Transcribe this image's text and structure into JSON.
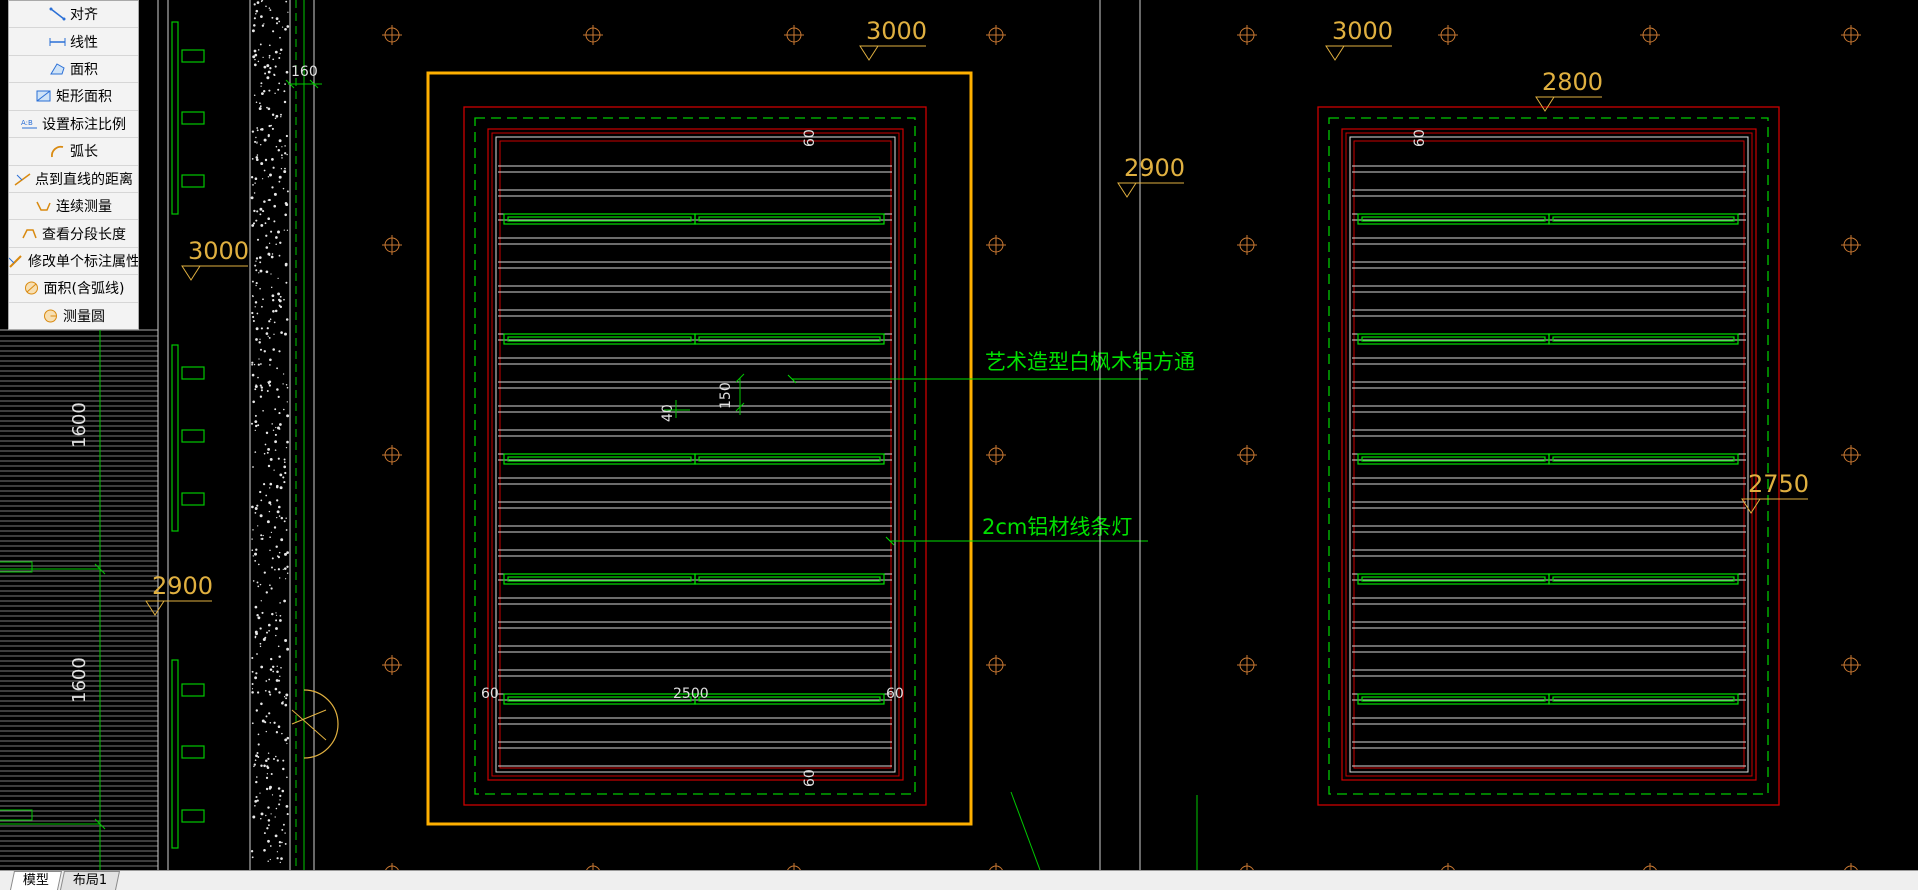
{
  "tools": [
    {
      "label": "对齐",
      "icon": "align-dimension-icon"
    },
    {
      "label": "线性",
      "icon": "linear-dimension-icon"
    },
    {
      "label": "面积",
      "icon": "area-icon"
    },
    {
      "label": "矩形面积",
      "icon": "rectangle-area-icon"
    },
    {
      "label": "设置标注比例",
      "icon": "annotation-scale-icon"
    },
    {
      "label": "弧长",
      "icon": "arc-length-icon"
    },
    {
      "label": "点到直线的距离",
      "icon": "point-to-line-distance-icon"
    },
    {
      "label": "连续测量",
      "icon": "continuous-measure-icon"
    },
    {
      "label": "查看分段长度",
      "icon": "segment-length-icon"
    },
    {
      "label": "修改单个标注属性",
      "icon": "edit-annotation-icon"
    },
    {
      "label": "面积(含弧线)",
      "icon": "area-with-arc-icon"
    },
    {
      "label": "测量圆",
      "icon": "measure-circle-icon"
    }
  ],
  "tabs": [
    {
      "label": "模型",
      "active": true
    },
    {
      "label": "布局1",
      "active": false
    }
  ],
  "drawing": {
    "annotations": {
      "aluminum_tube": "艺术造型白枫木铝方通",
      "strip_light": "2cm铝材线条灯"
    },
    "level_marks": {
      "top_left_3000": "3000",
      "top_right_3000": "3000",
      "right_panel_2800": "2800",
      "left_panel_2900": "2900",
      "left_3000": "3000",
      "left_2900": "2900",
      "right_2750": "2750"
    },
    "dimensions": {
      "wall_160": "160",
      "span_1600_top": "1600",
      "span_1600_bottom": "1600",
      "spacing_150": "150",
      "spacing_40": "40",
      "left_panel_width_2500": "2500",
      "left_panel_margin_left_60": "60",
      "left_panel_margin_right_60": "60",
      "left_panel_margin_top_60": "60",
      "left_panel_margin_bottom_60": "60",
      "right_panel_margin_top_60": "60"
    },
    "colors": {
      "background": "#000000",
      "frame_outline": "#FFB000",
      "panel_red": "#CC0000",
      "hidden_green": "#00C800",
      "annotation_green": "#00E000",
      "level_text": "#E0B040",
      "grid_marker": "#C87832",
      "slats": "#D8D8D8"
    }
  }
}
